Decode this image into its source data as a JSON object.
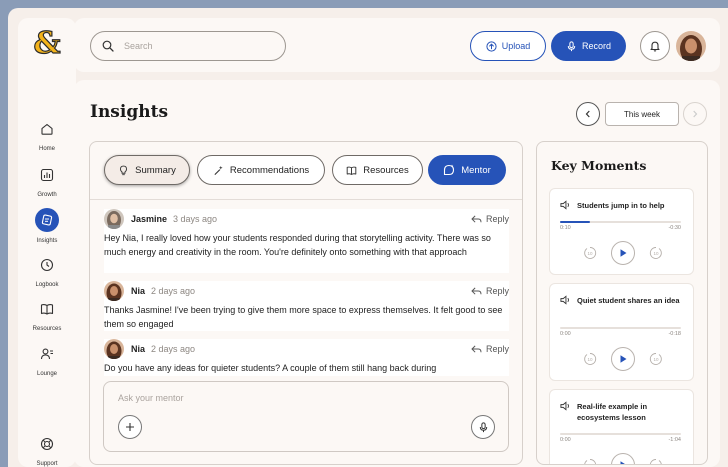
{
  "app": {
    "logo": "&"
  },
  "sidebar": {
    "items": [
      {
        "label": "Home",
        "icon": "home-icon",
        "active": false
      },
      {
        "label": "Growth",
        "icon": "chart-icon",
        "active": false
      },
      {
        "label": "Insights",
        "icon": "insights-icon",
        "active": true
      },
      {
        "label": "Logbook",
        "icon": "history-icon",
        "active": false
      },
      {
        "label": "Resources",
        "icon": "book-icon",
        "active": false
      },
      {
        "label": "Lounge",
        "icon": "people-icon",
        "active": false
      }
    ],
    "support_label": "Support"
  },
  "topbar": {
    "search_placeholder": "Search",
    "upload_label": "Upload",
    "record_label": "Record"
  },
  "main": {
    "title": "Insights",
    "period_label": "This week"
  },
  "tabs": [
    {
      "label": "Summary",
      "icon": "lightbulb-icon"
    },
    {
      "label": "Recommendations",
      "icon": "sparkle-wand-icon"
    },
    {
      "label": "Resources",
      "icon": "book-icon"
    },
    {
      "label": "Mentor",
      "icon": "chat-sparkle-icon"
    }
  ],
  "messages": [
    {
      "name": "Jasmine",
      "time": "3 days ago",
      "reply_label": "Reply",
      "text": "Hey Nia, I really loved how your students responded during that storytelling activity. There was so much energy and creativity in the room. You're definitely onto something with that approach"
    },
    {
      "name": "Nia",
      "time": "2 days ago",
      "reply_label": "Reply",
      "text": "Thanks Jasmine! I've been trying to give them more space to express themselves. It felt good to see them so engaged"
    },
    {
      "name": "Nia",
      "time": "2 days ago",
      "reply_label": "Reply",
      "text": "Do you have any ideas for quieter students? A couple of them still hang back during"
    }
  ],
  "composer": {
    "placeholder": "Ask your mentor"
  },
  "key_moments": {
    "title": "Key Moments",
    "clips": [
      {
        "title": "Students jump in to help",
        "elapsed": "0:10",
        "remaining": "-0:30",
        "progress": 0.25,
        "skip_seconds": "10"
      },
      {
        "title": "Quiet student shares an idea",
        "elapsed": "0:00",
        "remaining": "-0:18",
        "progress": 0,
        "skip_seconds": "10"
      },
      {
        "title": "Real-life example in ecosystems lesson",
        "elapsed": "0:00",
        "remaining": "-1:04",
        "progress": 0,
        "skip_seconds": "10"
      }
    ]
  },
  "colors": {
    "accent": "#2653b8",
    "background": "#f6efea",
    "logo": "#f3b31b"
  }
}
